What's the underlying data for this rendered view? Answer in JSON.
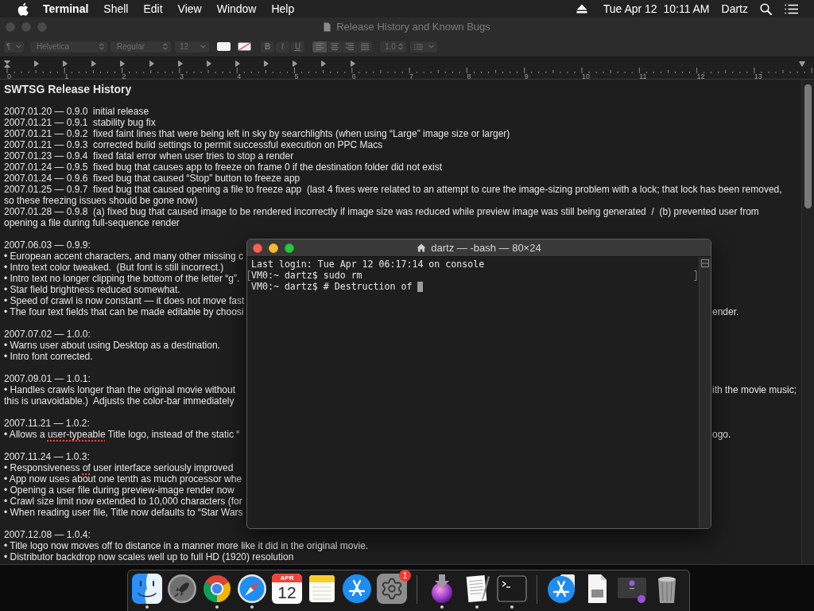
{
  "menu_bar": {
    "app_name": "Terminal",
    "menus": [
      "Shell",
      "Edit",
      "View",
      "Window",
      "Help"
    ],
    "clock": "Tue Apr 12  10:11 AM",
    "user": "Dartz"
  },
  "document_window": {
    "title": "Release History and Known Bugs",
    "active": false,
    "toolbar": {
      "paragraph_style": "¶",
      "font_family": "Helvetica",
      "typeface": "Regular",
      "font_size": "12",
      "style_buttons": [
        {
          "label": "B",
          "kind": "bold"
        },
        {
          "label": "I",
          "kind": "italic"
        },
        {
          "label": "U",
          "kind": "underline"
        }
      ],
      "alignment": [
        {
          "kind": "left",
          "selected": true
        },
        {
          "kind": "center",
          "selected": false
        },
        {
          "kind": "right",
          "selected": false
        },
        {
          "kind": "justify",
          "selected": false
        }
      ],
      "line_spacing": "1.0"
    },
    "ruler": {
      "labels": [
        "0",
        "1",
        "2",
        "3",
        "4",
        "5",
        "6",
        "7",
        "8",
        "9",
        "10",
        "11",
        "12",
        "13"
      ]
    },
    "document": {
      "heading": "SWTSG Release History",
      "paragraphs": [
        [
          {
            "text": "2007.01.20 — 0.9.0  initial release"
          },
          {
            "text": "2007.01.21 — 0.9.1  stability bug fix"
          },
          {
            "text": "2007.01.21 — 0.9.2  fixed faint lines that were being left in sky by searchlights (when using “Large” image size or larger)"
          },
          {
            "text": "2007.01.21 — 0.9.3  corrected build settings to permit successful execution on PPC Macs"
          },
          {
            "text": "2007.01.23 — 0.9.4  fixed fatal error when user tries to stop a render"
          },
          {
            "text": "2007.01.24 — 0.9.5  fixed bug that causes app to freeze on frame 0 if the destination folder did not exist"
          },
          {
            "text": "2007.01.24 — 0.9.6  fixed bug that caused “Stop” button to freeze app"
          },
          {
            "text": "2007.01.25 — 0.9.7  fixed bug that caused opening a file to freeze app  (last 4 fixes were related to an attempt to cure the image-sizing problem with a lock; that lock has been removed,"
          },
          {
            "text": "so these freezing issues should be gone now)"
          },
          {
            "text": "2007.01.28 — 0.9.8  (a) fixed bug that caused image to be rendered incorrectly if image size was reduced while preview image was still being generated  /  (b) prevented user from"
          },
          {
            "text": "opening a file during full-sequence render"
          }
        ],
        [
          {
            "text": "2007.06.03 — 0.9.9:"
          },
          {
            "text": "• European accent characters, and many other missing c"
          },
          {
            "text": "• Intro text color tweaked.  (But font is still incorrect.)"
          },
          {
            "text": "• Intro text no longer clipping the bottom of the letter “g”."
          },
          {
            "text": "• Star field brightness reduced somewhat."
          },
          {
            "text": "• Speed of crawl is now constant — it does not move fast"
          },
          {
            "text": "• The four text fields that can be made editable by choosi",
            "tail": "ender."
          }
        ],
        [
          {
            "text": "2007.07.02 — 1.0.0:"
          },
          {
            "text": "• Warns user about using Desktop as a destination."
          },
          {
            "text": "• Intro font corrected."
          }
        ],
        [
          {
            "text": "2007.09.01 — 1.0.1:"
          },
          {
            "text": "• Handles crawls longer than the original movie without",
            "tail": "ith the movie music;"
          },
          {
            "text": "this is unavoidable.)  Adjusts the color-bar immediately"
          }
        ],
        [
          {
            "text": "2007.11.21 — 1.0.2:"
          },
          {
            "segments": [
              {
                "text": "• Allows a ",
                "misspelled": false
              },
              {
                "text": "user-typeable",
                "misspelled": true
              },
              {
                "text": " Title logo, instead of the static “",
                "misspelled": false
              }
            ],
            "tail": "ogo."
          }
        ],
        [
          {
            "text": "2007.11.24 — 1.0.3:"
          },
          {
            "segments": [
              {
                "text": "• Responsiveness ",
                "misspelled": false
              },
              {
                "text": "of",
                "misspelled": true
              },
              {
                "text": " user interface seriously improved",
                "misspelled": false
              }
            ]
          },
          {
            "text": "• App now uses about one tenth as much processor whe"
          },
          {
            "text": "• Opening a user file during preview-image render now"
          },
          {
            "text": "• Crawl size limit now extended to 10,000 characters (for"
          },
          {
            "text": "• When reading user file, Title now defaults to “Star Wars"
          }
        ],
        [
          {
            "text": "2007.12.08 — 1.0.4:"
          },
          {
            "text": "• Title logo now moves off to distance in a manner more like it did in the original movie."
          },
          {
            "text": "• Distributor backdrop now scales well up to full HD (1920) resolution"
          }
        ]
      ]
    }
  },
  "terminal_window": {
    "title": "dartz — -bash — 80×24",
    "active": true,
    "lines": [
      {
        "text": "Last login: Tue Apr 12 06:17:14 on console",
        "marked": false,
        "cursor": false
      },
      {
        "text": "VM0:~ dartz$ sudo rm",
        "marked": true,
        "cursor": false
      },
      {
        "text": "VM0:~ dartz$ # Destruction of",
        "marked": false,
        "cursor": true
      }
    ]
  },
  "dock": {
    "items": [
      {
        "kind": "finder",
        "running": true
      },
      {
        "kind": "launchpad",
        "running": false
      },
      {
        "kind": "chrome",
        "running": true
      },
      {
        "kind": "safari",
        "running": true
      },
      {
        "kind": "calendar",
        "running": false,
        "month": "APR",
        "day": "12"
      },
      {
        "kind": "notes",
        "running": false
      },
      {
        "kind": "app_store",
        "running": false
      },
      {
        "kind": "system_preferences",
        "running": false,
        "badge": "1"
      },
      {
        "kind": "separator"
      },
      {
        "kind": "downloads",
        "running": true
      },
      {
        "kind": "textedit",
        "running": true
      },
      {
        "kind": "terminal",
        "running": true
      },
      {
        "kind": "separator"
      },
      {
        "kind": "app_store_stack",
        "running": false
      },
      {
        "kind": "document",
        "running": false
      },
      {
        "kind": "screenshots",
        "running": false
      },
      {
        "kind": "trash",
        "running": false
      }
    ]
  }
}
